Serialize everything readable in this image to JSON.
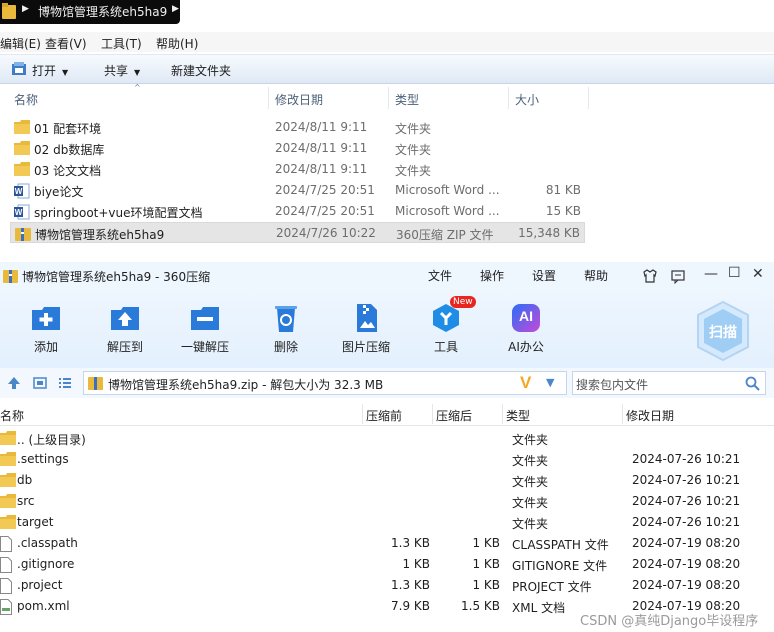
{
  "explorer": {
    "address": "博物馆管理系统eh5ha9",
    "menu": [
      "编辑(E)",
      "查看(V)",
      "工具(T)",
      "帮助(H)"
    ],
    "toolbar": {
      "open": "打开",
      "share": "共享",
      "new_folder": "新建文件夹"
    },
    "columns": {
      "name": "名称",
      "date": "修改日期",
      "type": "类型",
      "size": "大小"
    },
    "rows": [
      {
        "name": "01 配套环境",
        "date": "2024/8/11 9:11",
        "type": "文件夹",
        "size": "",
        "icon": "folder-icon"
      },
      {
        "name": "02 db数据库",
        "date": "2024/8/11 9:11",
        "type": "文件夹",
        "size": "",
        "icon": "folder-icon"
      },
      {
        "name": "03 论文文档",
        "date": "2024/8/11 9:11",
        "type": "文件夹",
        "size": "",
        "icon": "folder-icon"
      },
      {
        "name": "biye论文",
        "date": "2024/7/25 20:51",
        "type": "Microsoft Word ...",
        "size": "81 KB",
        "icon": "word-icon"
      },
      {
        "name": "springboot+vue环境配置文档",
        "date": "2024/7/25 20:51",
        "type": "Microsoft Word ...",
        "size": "15 KB",
        "icon": "word-icon"
      },
      {
        "name": "博物馆管理系统eh5ha9",
        "date": "2024/7/26 10:22",
        "type": "360压缩 ZIP 文件",
        "size": "15,348 KB",
        "icon": "zip-icon"
      }
    ]
  },
  "zip": {
    "title": "博物馆管理系统eh5ha9 - 360压缩",
    "menu": {
      "file": "文件",
      "ops": "操作",
      "settings": "设置",
      "help": "帮助"
    },
    "ribbon": {
      "add": "添加",
      "extract_to": "解压到",
      "one_click": "一键解压",
      "delete": "删除",
      "image_compress": "图片压缩",
      "tools": "工具",
      "ai_office": "AI办公",
      "new_badge": "New",
      "scan": "扫描",
      "ai_icon_text": "AI"
    },
    "path": "博物馆管理系统eh5ha9.zip - 解包大小为 32.3 MB",
    "search_placeholder": "搜索包内文件",
    "columns": {
      "name": "名称",
      "compressed_before": "压缩前",
      "compressed_after": "压缩后",
      "type": "类型",
      "modified": "修改日期"
    },
    "rows": [
      {
        "name": ".. (上级目录)",
        "before": "",
        "after": "",
        "type": "文件夹",
        "date": "",
        "icon": "folder-icon"
      },
      {
        "name": ".settings",
        "before": "",
        "after": "",
        "type": "文件夹",
        "date": "2024-07-26 10:21",
        "icon": "folder-icon"
      },
      {
        "name": "db",
        "before": "",
        "after": "",
        "type": "文件夹",
        "date": "2024-07-26 10:21",
        "icon": "folder-icon"
      },
      {
        "name": "src",
        "before": "",
        "after": "",
        "type": "文件夹",
        "date": "2024-07-26 10:21",
        "icon": "folder-icon"
      },
      {
        "name": "target",
        "before": "",
        "after": "",
        "type": "文件夹",
        "date": "2024-07-26 10:21",
        "icon": "folder-icon"
      },
      {
        "name": ".classpath",
        "before": "1.3 KB",
        "after": "1 KB",
        "type": "CLASSPATH 文件",
        "date": "2024-07-19 08:20",
        "icon": "file-icon"
      },
      {
        "name": ".gitignore",
        "before": "1 KB",
        "after": "1 KB",
        "type": "GITIGNORE 文件",
        "date": "2024-07-19 08:20",
        "icon": "file-icon"
      },
      {
        "name": ".project",
        "before": "1.3 KB",
        "after": "1 KB",
        "type": "PROJECT 文件",
        "date": "2024-07-19 08:20",
        "icon": "file-icon"
      },
      {
        "name": "pom.xml",
        "before": "7.9 KB",
        "after": "1.5 KB",
        "type": "XML 文档",
        "date": "2024-07-19 08:20",
        "icon": "xml-file-icon"
      }
    ]
  },
  "watermark": "CSDN @真纯Django毕设程序"
}
